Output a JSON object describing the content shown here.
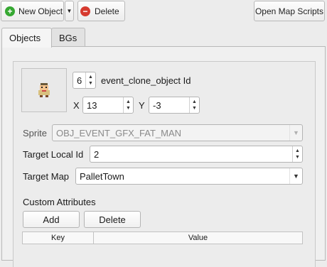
{
  "toolbar": {
    "new_object_label": "New Object",
    "delete_label": "Delete",
    "open_scripts_label": "Open Map Scripts"
  },
  "tabs": [
    {
      "label": "Objects",
      "active": true
    },
    {
      "label": "BGs",
      "active": false
    }
  ],
  "object": {
    "index_value": "6",
    "type_label": "event_clone_object Id",
    "x_label": "X",
    "x_value": "13",
    "y_label": "Y",
    "y_value": "-3",
    "sprite_label": "Sprite",
    "sprite_value": "OBJ_EVENT_GFX_FAT_MAN",
    "sprite_disabled": true,
    "target_local_id_label": "Target Local Id",
    "target_local_id_value": "2",
    "target_map_label": "Target Map",
    "target_map_value": "PalletTown"
  },
  "custom_attributes": {
    "heading": "Custom Attributes",
    "add_label": "Add",
    "delete_label": "Delete",
    "columns": [
      "Key",
      "Value"
    ]
  },
  "colors": {
    "add_icon": "#36a832",
    "delete_icon": "#d63a2f"
  }
}
